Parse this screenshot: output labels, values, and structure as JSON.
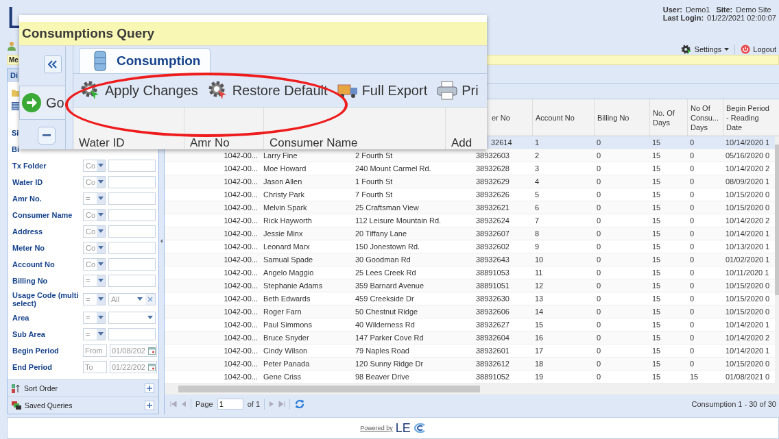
{
  "header": {
    "logo": "L",
    "user_label": "User:",
    "user": "Demo1",
    "site_label": "Site:",
    "site": "Demo Site",
    "login_label": "Last Login:",
    "last_login": "01/22/2021 02:00:07",
    "settings": "Settings",
    "logout": "Logout"
  },
  "menu_bar": {
    "label": "Me"
  },
  "left_panel": {
    "tab": "Di",
    "cut_labels": [
      "Si",
      "Bi"
    ],
    "filters": [
      {
        "label": "Tx Folder",
        "kind": "text",
        "op": "Co"
      },
      {
        "label": "Water ID",
        "kind": "text",
        "op": "Co"
      },
      {
        "label": "Amr No.",
        "kind": "text",
        "op": "="
      },
      {
        "label": "Consumer Name",
        "kind": "text",
        "op": "Co"
      },
      {
        "label": "Address",
        "kind": "text",
        "op": "Co"
      },
      {
        "label": "Meter No",
        "kind": "text",
        "op": "Co"
      },
      {
        "label": "Account No",
        "kind": "text",
        "op": "Co"
      },
      {
        "label": "Billing No",
        "kind": "text",
        "op": "="
      },
      {
        "label": "Usage Code (multi select)",
        "kind": "multi",
        "op": "=",
        "value": "All"
      },
      {
        "label": "Area",
        "kind": "combo",
        "op": "="
      },
      {
        "label": "Sub Area",
        "kind": "text",
        "op": "="
      },
      {
        "label": "Begin Period",
        "kind": "date",
        "placeholder": "From",
        "value": "01/08/202"
      },
      {
        "label": "End Period",
        "kind": "date",
        "placeholder": "To",
        "value": "01/22/202"
      }
    ],
    "sections": [
      {
        "label": "Sort Order",
        "kind": "sort"
      },
      {
        "label": "Saved Queries",
        "kind": "saved"
      }
    ]
  },
  "table": {
    "columns": [
      "er No",
      "Account No",
      "Billing No",
      "No. Of Days",
      "No Of Consu... Days",
      "Begin Period - Reading Date"
    ],
    "rows": [
      {
        "selected": true,
        "meter": "32614",
        "account": "1",
        "billing": "0",
        "days": "15",
        "consu_days": "0",
        "begin": "10/14/2020 1"
      },
      {
        "selected": false,
        "amr": "1042-00...",
        "name": "Larry Fine",
        "address": "2 Fourth St",
        "meter": "38932603",
        "account": "2",
        "billing": "0",
        "days": "15",
        "consu_days": "0",
        "begin": "05/16/2020 0"
      },
      {
        "selected": false,
        "amr": "1042-00...",
        "name": "Moe Howard",
        "address": "240 Mount Carmel Rd.",
        "meter": "38932628",
        "account": "3",
        "billing": "0",
        "days": "15",
        "consu_days": "0",
        "begin": "10/14/2020 2"
      },
      {
        "selected": false,
        "amr": "1042-00...",
        "name": "Jason Allen",
        "address": "1 Fourth St",
        "meter": "38932629",
        "account": "4",
        "billing": "0",
        "days": "15",
        "consu_days": "0",
        "begin": "08/09/2020 1"
      },
      {
        "selected": false,
        "amr": "1042-00...",
        "name": "Christy Park",
        "address": "7 Fourth St",
        "meter": "38932626",
        "account": "5",
        "billing": "0",
        "days": "15",
        "consu_days": "0",
        "begin": "10/15/2020 0"
      },
      {
        "selected": false,
        "amr": "1042-00...",
        "name": "Melvin Spark",
        "address": "25 Craftsman View",
        "meter": "38932621",
        "account": "6",
        "billing": "0",
        "days": "15",
        "consu_days": "0",
        "begin": "10/15/2020 0"
      },
      {
        "selected": false,
        "amr": "1042-00...",
        "name": "Rick Hayworth",
        "address": "112 Leisure Mountain Rd.",
        "meter": "38932624",
        "account": "7",
        "billing": "0",
        "days": "15",
        "consu_days": "0",
        "begin": "10/14/2020 2"
      },
      {
        "selected": false,
        "amr": "1042-00...",
        "name": "Jessie Minx",
        "address": "20 Tiffany Lane",
        "meter": "38932607",
        "account": "8",
        "billing": "0",
        "days": "15",
        "consu_days": "0",
        "begin": "10/14/2020 1"
      },
      {
        "selected": false,
        "amr": "1042-00...",
        "name": "Leonard Marx",
        "address": "150 Jonestown Rd.",
        "meter": "38932602",
        "account": "9",
        "billing": "0",
        "days": "15",
        "consu_days": "0",
        "begin": "10/13/2020 1"
      },
      {
        "selected": false,
        "amr": "1042-00...",
        "name": "Samual Spade",
        "address": "30 Goodman Rd",
        "meter": "38932643",
        "account": "10",
        "billing": "0",
        "days": "15",
        "consu_days": "0",
        "begin": "01/02/2020 1"
      },
      {
        "selected": false,
        "amr": "1042-00...",
        "name": "Angelo Maggio",
        "address": "25 Lees Creek Rd",
        "meter": "38891053",
        "account": "11",
        "billing": "0",
        "days": "15",
        "consu_days": "0",
        "begin": "10/11/2020 1"
      },
      {
        "selected": false,
        "amr": "1042-00...",
        "name": "Stephanie Adams",
        "address": "359 Barnard Avenue",
        "meter": "38891051",
        "account": "12",
        "billing": "0",
        "days": "15",
        "consu_days": "0",
        "begin": "10/15/2020 0"
      },
      {
        "selected": false,
        "amr": "1042-00...",
        "name": "Beth Edwards",
        "address": "459 Creekside Dr",
        "meter": "38932630",
        "account": "13",
        "billing": "0",
        "days": "15",
        "consu_days": "0",
        "begin": "10/15/2020 0"
      },
      {
        "selected": false,
        "amr": "1042-00...",
        "name": "Roger Farn",
        "address": "50 Chestnut Ridge",
        "meter": "38932606",
        "account": "14",
        "billing": "0",
        "days": "15",
        "consu_days": "0",
        "begin": "10/15/2020 0"
      },
      {
        "selected": false,
        "amr": "1042-00...",
        "name": "Paul Simmons",
        "address": "40 Wilderness Rd",
        "meter": "38932627",
        "account": "15",
        "billing": "0",
        "days": "15",
        "consu_days": "0",
        "begin": "10/14/2020 1"
      },
      {
        "selected": false,
        "amr": "1042-00...",
        "name": "Bruce Snyder",
        "address": "147 Parker Cove Rd",
        "meter": "38932604",
        "account": "16",
        "billing": "0",
        "days": "15",
        "consu_days": "0",
        "begin": "10/14/2020 2"
      },
      {
        "selected": false,
        "amr": "1042-00...",
        "name": "Cindy Wilson",
        "address": "79 Naples Road",
        "meter": "38932601",
        "account": "17",
        "billing": "0",
        "days": "15",
        "consu_days": "0",
        "begin": "10/14/2020 1"
      },
      {
        "selected": false,
        "amr": "1042-00...",
        "name": "Peter Panada",
        "address": "120 Sunny Ridge Dr",
        "meter": "38932612",
        "account": "18",
        "billing": "0",
        "days": "15",
        "consu_days": "0",
        "begin": "10/15/2020 0"
      },
      {
        "selected": false,
        "amr": "1042-00...",
        "name": "Gene Criss",
        "address": "98 Beaver Drive",
        "meter": "38891052",
        "account": "19",
        "billing": "0",
        "days": "15",
        "consu_days": "15",
        "begin": "01/08/2021 0"
      }
    ]
  },
  "pager": {
    "page_label": "Page",
    "page": "1",
    "of": "of 1",
    "summary": "Consumption 1 - 30 of 30"
  },
  "footer": {
    "powered_by": "Powered by",
    "logo": "LE"
  },
  "overlay": {
    "title": "Consumptions Query",
    "go": "Go",
    "tab": "Consumption",
    "toolbar": [
      {
        "label": "Apply Changes",
        "kind": "apply"
      },
      {
        "label": "Restore Default",
        "kind": "restore"
      },
      {
        "label": "Full Export",
        "kind": "export"
      },
      {
        "label": "Pri",
        "kind": "print"
      }
    ],
    "columns": [
      "Water ID",
      "Amr No",
      "Consumer Name",
      "Add"
    ]
  }
}
